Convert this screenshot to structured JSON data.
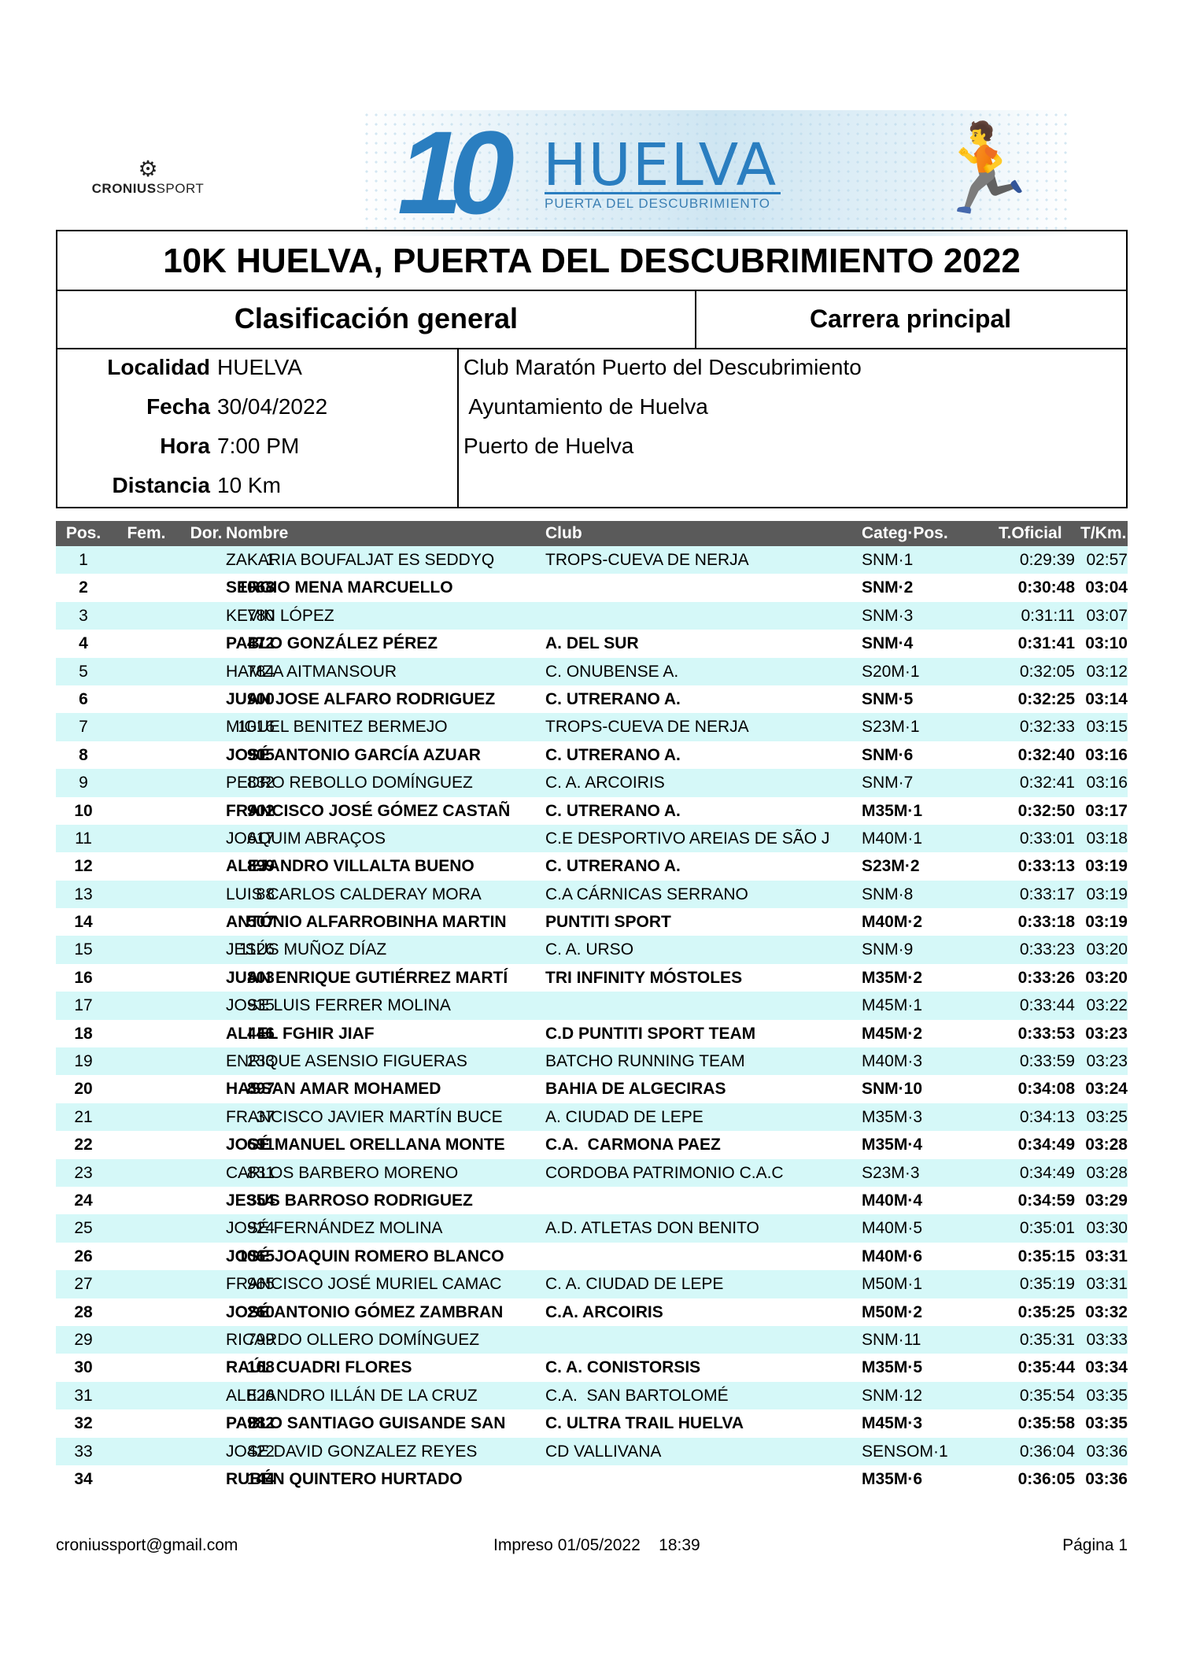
{
  "logo": {
    "big_number": "10",
    "brand": "HUELVA",
    "tagline": "PUERTA DEL DESCUBRIMIENTO",
    "sponsor_bold": "CRONIUS",
    "sponsor_light": "SPORT"
  },
  "title": "10K HUELVA, PUERTA DEL DESCUBRIMIENTO 2022",
  "subtitle_left": "Clasificación general",
  "subtitle_right": "Carrera principal",
  "info": [
    {
      "label": "Localidad",
      "value": "HUELVA"
    },
    {
      "label": "Fecha",
      "value": "30/04/2022"
    },
    {
      "label": "Hora",
      "value": "7:00 PM"
    },
    {
      "label": "Distancia",
      "value": "10 Km"
    }
  ],
  "organizers": [
    "Club Maratón Puerto del Descubrimiento",
    " Ayuntamiento de Huelva",
    "Puerto de Huelva"
  ],
  "columns": {
    "pos": "Pos.",
    "fem": "Fem.",
    "dor": "Dor.",
    "name": "Nombre",
    "club": "Club",
    "cat": "Categ·Pos.",
    "tof": "T.Oficial",
    "tkm": "T/Km."
  },
  "rows": [
    {
      "pos": "1",
      "dor": "1",
      "name": "ZAKARIA BOUFALJAT ES SEDDYQ",
      "club": "TROPS-CUEVA DE NERJA",
      "cat": "SNM·1",
      "tof": "0:29:39",
      "tkm": "02:57"
    },
    {
      "pos": "2",
      "dor": "1068",
      "name": "SERGIO MENA MARCUELLO",
      "club": "",
      "cat": "SNM·2",
      "tof": "0:30:48",
      "tkm": "03:04"
    },
    {
      "pos": "3",
      "dor": "780",
      "name": "KEVIN LÓPEZ",
      "club": "",
      "cat": "SNM·3",
      "tof": "0:31:11",
      "tkm": "03:07"
    },
    {
      "pos": "4",
      "dor": "472",
      "name": "PABLO GONZÁLEZ PÉREZ",
      "club": "A. DEL SUR",
      "cat": "SNM·4",
      "tof": "0:31:41",
      "tkm": "03:10"
    },
    {
      "pos": "5",
      "dor": "784",
      "name": "HAMZA AITMANSOUR",
      "club": "C. ONUBENSE A.",
      "cat": "S20M·1",
      "tof": "0:32:05",
      "tkm": "03:12"
    },
    {
      "pos": "6",
      "dor": "900",
      "name": "JUAN JOSE ALFARO RODRIGUEZ",
      "club": "C. UTRERANO A.",
      "cat": "SNM·5",
      "tof": "0:32:25",
      "tkm": "03:14"
    },
    {
      "pos": "7",
      "dor": "1016",
      "name": "MIGUEL BENITEZ BERMEJO",
      "club": "TROPS-CUEVA DE NERJA",
      "cat": "S23M·1",
      "tof": "0:32:33",
      "tkm": "03:15"
    },
    {
      "pos": "8",
      "dor": "905",
      "name": "JOSÉ ANTONIO GARCÍA AZUAR",
      "club": "C. UTRERANO A.",
      "cat": "SNM·6",
      "tof": "0:32:40",
      "tkm": "03:16"
    },
    {
      "pos": "9",
      "dor": "832",
      "name": "PEDRO REBOLLO DOMÍNGUEZ",
      "club": "C. A. ARCOIRIS",
      "cat": "SNM·7",
      "tof": "0:32:41",
      "tkm": "03:16"
    },
    {
      "pos": "10",
      "dor": "902",
      "name": "FRANCISCO JOSÉ GÓMEZ CASTAÑ",
      "club": "C. UTRERANO A.",
      "cat": "M35M·1",
      "tof": "0:32:50",
      "tkm": "03:17"
    },
    {
      "pos": "11",
      "dor": "617",
      "name": "JOAQUIM ABRAÇOS",
      "club": "C.E DESPORTIVO AREIAS DE SÃO J",
      "cat": "M40M·1",
      "tof": "0:33:01",
      "tkm": "03:18"
    },
    {
      "pos": "12",
      "dor": "899",
      "name": "ALEJANDRO VILLALTA BUENO",
      "club": "C. UTRERANO A.",
      "cat": "S23M·2",
      "tof": "0:33:13",
      "tkm": "03:19"
    },
    {
      "pos": "13",
      "dor": "88",
      "name": "LUIS CARLOS CALDERAY MORA",
      "club": "C.A CÁRNICAS SERRANO",
      "cat": "SNM·8",
      "tof": "0:33:17",
      "tkm": "03:19"
    },
    {
      "pos": "14",
      "dor": "507",
      "name": "ANTÓNIO ALFARROBINHA MARTIN",
      "club": "PUNTITI SPORT",
      "cat": "M40M·2",
      "tof": "0:33:18",
      "tkm": "03:19"
    },
    {
      "pos": "15",
      "dor": "1126",
      "name": "JESÚS MUÑOZ DÍAZ",
      "club": "C. A. URSO",
      "cat": "SNM·9",
      "tof": "0:33:23",
      "tkm": "03:20"
    },
    {
      "pos": "16",
      "dor": "803",
      "name": "JUAN ENRIQUE GUTIÉRREZ MARTÍ",
      "club": "TRI INFINITY MÓSTOLES",
      "cat": "M35M·2",
      "tof": "0:33:26",
      "tkm": "03:20"
    },
    {
      "pos": "17",
      "dor": "935",
      "name": "JOSE LUIS FERRER MOLINA",
      "club": "",
      "cat": "M45M·1",
      "tof": "0:33:44",
      "tkm": "03:22"
    },
    {
      "pos": "18",
      "dor": "446",
      "name": "ALI EL FGHIR JIAF",
      "club": "C.D PUNTITI SPORT TEAM",
      "cat": "M45M·2",
      "tof": "0:33:53",
      "tkm": "03:23"
    },
    {
      "pos": "19",
      "dor": "233",
      "name": "ENRIQUE ASENSIO FIGUERAS",
      "club": "BATCHO RUNNING TEAM",
      "cat": "M40M·3",
      "tof": "0:33:59",
      "tkm": "03:23"
    },
    {
      "pos": "20",
      "dor": "897",
      "name": "HASSAN AMAR MOHAMED",
      "club": "BAHIA DE ALGECIRAS",
      "cat": "SNM·10",
      "tof": "0:34:08",
      "tkm": "03:24"
    },
    {
      "pos": "21",
      "dor": "37",
      "name": "FRANCISCO JAVIER MARTÍN BUCE",
      "club": "A. CIUDAD DE LEPE",
      "cat": "M35M·3",
      "tof": "0:34:13",
      "tkm": "03:25"
    },
    {
      "pos": "22",
      "dor": "691",
      "name": "JOSÉ MANUEL ORELLANA MONTE",
      "club": "C.A.  CARMONA PAEZ",
      "cat": "M35M·4",
      "tof": "0:34:49",
      "tkm": "03:28"
    },
    {
      "pos": "23",
      "dor": "831",
      "name": "CARLOS BARBERO MORENO",
      "club": "CORDOBA PATRIMONIO C.A.C",
      "cat": "S23M·3",
      "tof": "0:34:49",
      "tkm": "03:28"
    },
    {
      "pos": "24",
      "dor": "354",
      "name": "JESUS BARROSO RODRIGUEZ",
      "club": "",
      "cat": "M40M·4",
      "tof": "0:34:59",
      "tkm": "03:29"
    },
    {
      "pos": "25",
      "dor": "924",
      "name": "JOSÉ FERNÁNDEZ MOLINA",
      "club": "A.D. ATLETAS DON BENITO",
      "cat": "M40M·5",
      "tof": "0:35:01",
      "tkm": "03:30"
    },
    {
      "pos": "26",
      "dor": "1065",
      "name": "JOSÉ JOAQUIN ROMERO BLANCO",
      "club": "",
      "cat": "M40M·6",
      "tof": "0:35:15",
      "tkm": "03:31"
    },
    {
      "pos": "27",
      "dor": "965",
      "name": "FRANCISCO JOSÉ MURIEL CAMAC",
      "club": "C. A. CIUDAD DE LEPE",
      "cat": "M50M·1",
      "tof": "0:35:19",
      "tkm": "03:31"
    },
    {
      "pos": "28",
      "dor": "260",
      "name": "JOSÉ ANTONIO GÓMEZ ZAMBRAN",
      "club": "C.A. ARCOIRIS",
      "cat": "M50M·2",
      "tof": "0:35:25",
      "tkm": "03:32"
    },
    {
      "pos": "29",
      "dor": "799",
      "name": "RICARDO OLLERO DOMÍNGUEZ",
      "club": "",
      "cat": "SNM·11",
      "tof": "0:35:31",
      "tkm": "03:33"
    },
    {
      "pos": "30",
      "dor": "168",
      "name": "RAÚL CUADRI FLORES",
      "club": "C. A. CONISTORSIS",
      "cat": "M35M·5",
      "tof": "0:35:44",
      "tkm": "03:34"
    },
    {
      "pos": "31",
      "dor": "826",
      "name": "ALEJANDRO ILLÁN DE LA CRUZ",
      "club": "C.A.  SAN BARTOLOMÉ",
      "cat": "SNM·12",
      "tof": "0:35:54",
      "tkm": "03:35"
    },
    {
      "pos": "32",
      "dor": "982",
      "name": "PABLO SANTIAGO GUISANDE SAN",
      "club": "C. ULTRA TRAIL HUELVA",
      "cat": "M45M·3",
      "tof": "0:35:58",
      "tkm": "03:35"
    },
    {
      "pos": "33",
      "dor": "422",
      "name": "JOSE DAVID GONZALEZ REYES",
      "club": "CD VALLIVANA",
      "cat": "SENSOM·1",
      "tof": "0:36:04",
      "tkm": "03:36"
    },
    {
      "pos": "34",
      "dor": "144",
      "name": "RUBÉN QUINTERO HURTADO",
      "club": "",
      "cat": "M35M·6",
      "tof": "0:36:05",
      "tkm": "03:36"
    }
  ],
  "footer": {
    "email": "croniussport@gmail.com",
    "printed": "Impreso 01/05/2022    18:39",
    "page": "Página 1"
  },
  "colors": {
    "row_alt": "#d5f8f8",
    "header_bg": "#5a5a5a",
    "brand_blue": "#2a7ec0"
  }
}
